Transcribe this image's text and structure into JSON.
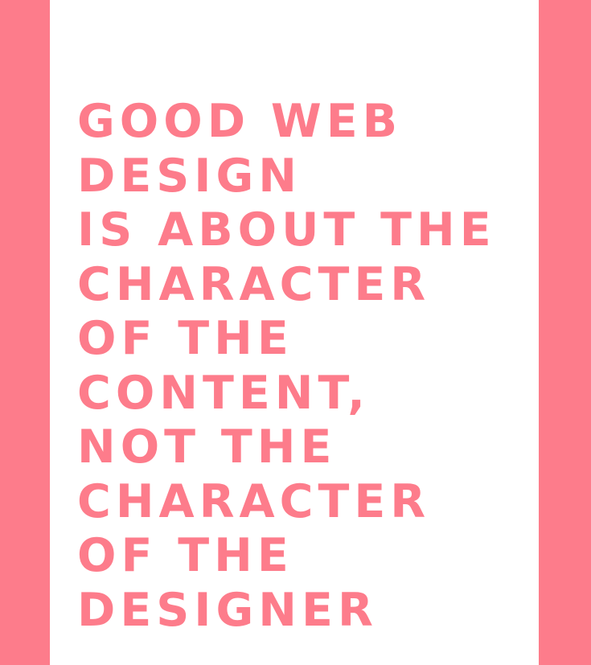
{
  "colors": {
    "accent": "#fd7c8b",
    "background": "#ffffff"
  },
  "quote": {
    "lines": [
      "GOOD WEB",
      "DESIGN",
      "IS ABOUT THE",
      "CHARACTER",
      "OF THE",
      "CONTENT,",
      "NOT THE",
      "CHARACTER",
      "OF THE",
      "DESIGNER"
    ]
  }
}
